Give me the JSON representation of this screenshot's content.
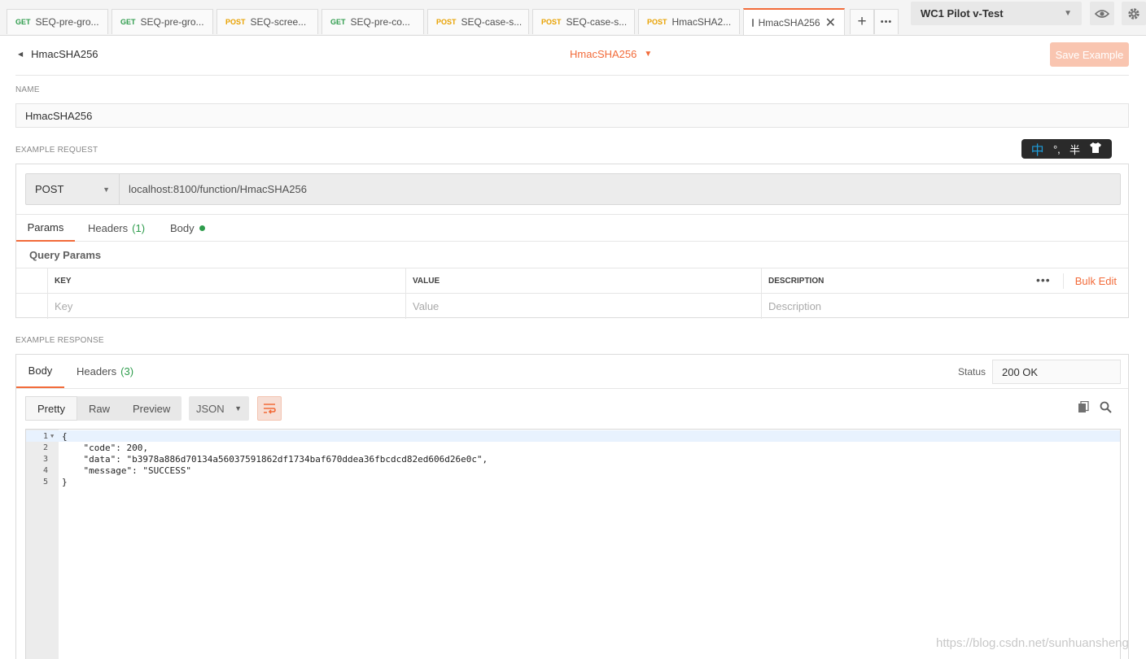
{
  "tabs": [
    {
      "method": "GET",
      "label": "SEQ-pre-gro..."
    },
    {
      "method": "GET",
      "label": "SEQ-pre-gro..."
    },
    {
      "method": "POST",
      "label": "SEQ-scree..."
    },
    {
      "method": "GET",
      "label": "SEQ-pre-co..."
    },
    {
      "method": "POST",
      "label": "SEQ-case-s..."
    },
    {
      "method": "POST",
      "label": "SEQ-case-s..."
    },
    {
      "method": "POST",
      "label": "HmacSHA2..."
    }
  ],
  "active_tab": {
    "label": "HmacSHA256",
    "close": "✕"
  },
  "tab_actions": {
    "add": "+",
    "more": "•••"
  },
  "environment": {
    "selected": "WC1 Pilot v-Test"
  },
  "icons": {
    "eye": "eye-icon",
    "settings": "gear-icon",
    "copy": "copy-icon",
    "search": "search-icon",
    "wrap": "wrap-lines-icon"
  },
  "header": {
    "back_label": "HmacSHA256",
    "center_title": "HmacSHA256",
    "save_button": "Save Example"
  },
  "name_section": {
    "label": "NAME",
    "value": "HmacSHA256"
  },
  "ime": {
    "mode": "中",
    "punct": "°,",
    "width": "半"
  },
  "request": {
    "label": "EXAMPLE REQUEST",
    "method": "POST",
    "url": "localhost:8100/function/HmacSHA256",
    "tabs": {
      "params": "Params",
      "headers": "Headers",
      "headers_count": "(1)",
      "body": "Body"
    },
    "query_params_title": "Query Params",
    "columns": {
      "key": "KEY",
      "value": "VALUE",
      "description": "DESCRIPTION"
    },
    "placeholders": {
      "key": "Key",
      "value": "Value",
      "description": "Description"
    },
    "bulk_edit": "Bulk Edit",
    "more": "•••"
  },
  "response": {
    "label": "EXAMPLE RESPONSE",
    "tabs": {
      "body": "Body",
      "headers": "Headers",
      "headers_count": "(3)"
    },
    "status_label": "Status",
    "status_value": "200 OK",
    "formats": [
      "Pretty",
      "Raw",
      "Preview"
    ],
    "language": "JSON",
    "code_lines": [
      {
        "num": "1",
        "text": "{"
      },
      {
        "num": "2",
        "text": "    \"code\": 200,"
      },
      {
        "num": "3",
        "text": "    \"data\": \"b3978a886d70134a56037591862df1734baf670ddea36fbcdcd82ed606d26e0c\","
      },
      {
        "num": "4",
        "text": "    \"message\": \"SUCCESS\""
      },
      {
        "num": "5",
        "text": "}"
      }
    ]
  },
  "watermark": "https://blog.csdn.net/sunhuansheng",
  "colors": {
    "accent": "#f26b3a",
    "get": "#2e9c4c",
    "post": "#e8a100"
  }
}
